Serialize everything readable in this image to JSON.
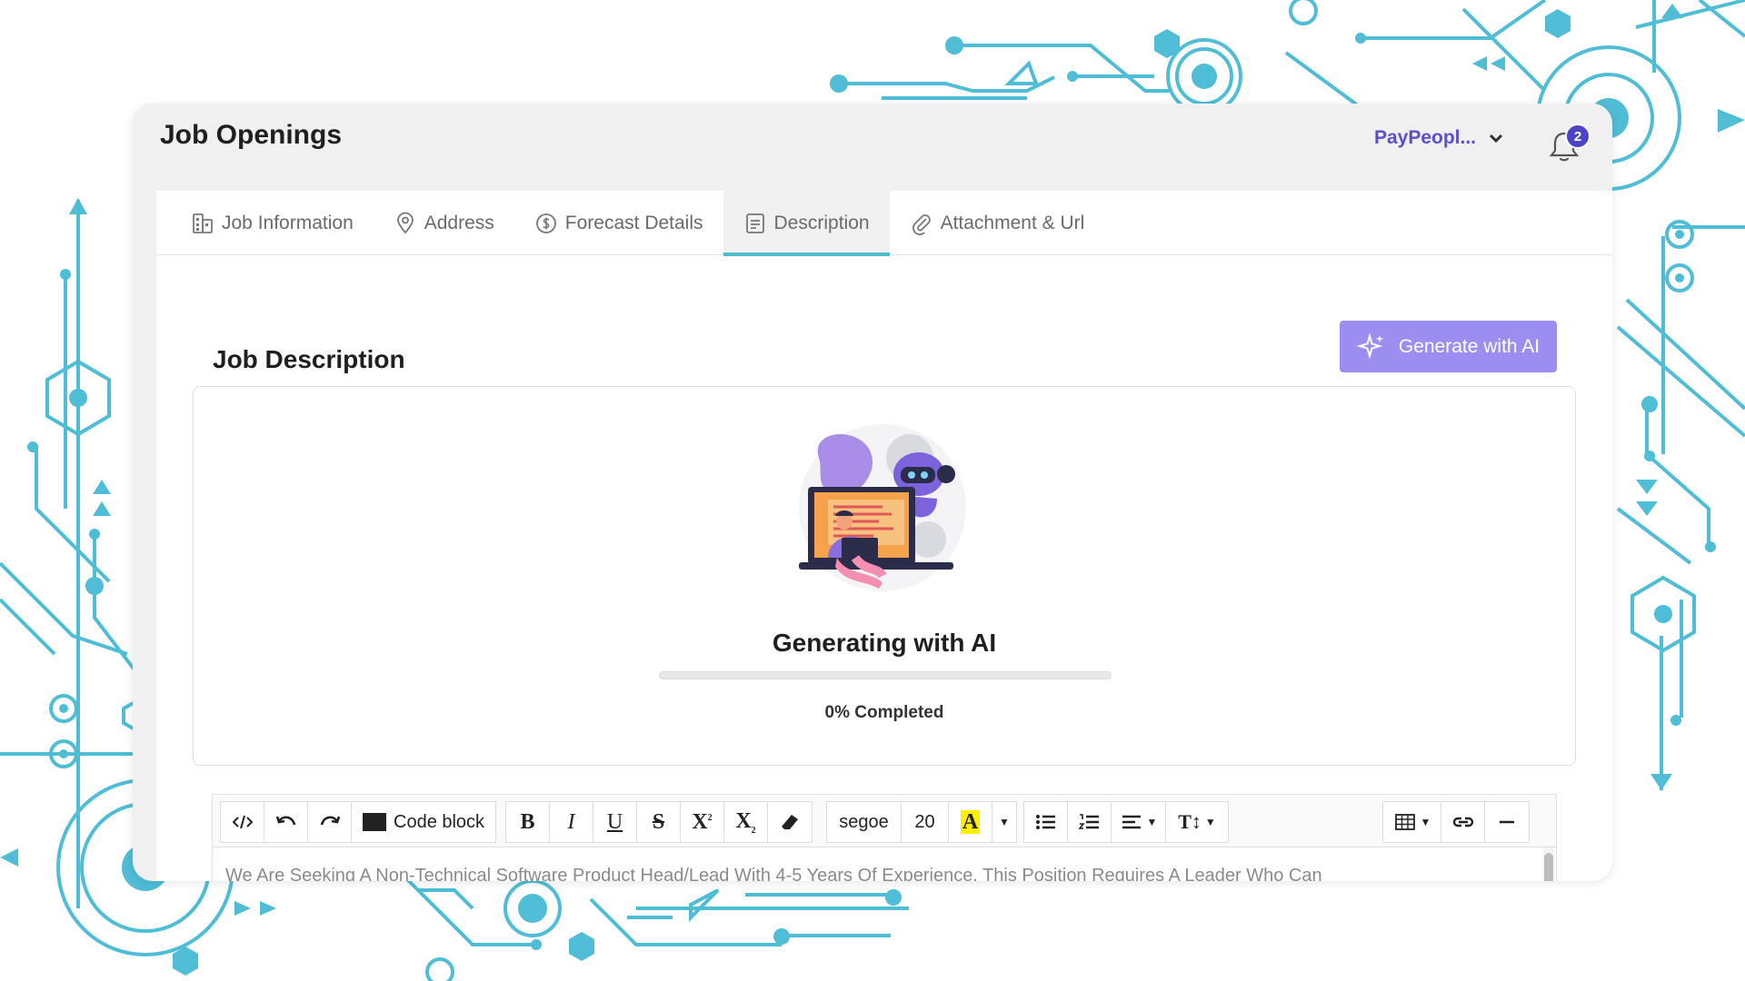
{
  "header": {
    "title": "Job Openings",
    "org_name": "PayPeopl...",
    "notification_count": "2"
  },
  "tabs": [
    {
      "label": "Job Information",
      "icon": "building-icon"
    },
    {
      "label": "Address",
      "icon": "location-pin-icon"
    },
    {
      "label": "Forecast Details",
      "icon": "dollar-coin-icon"
    },
    {
      "label": "Description",
      "icon": "document-icon",
      "active": true
    },
    {
      "label": "Attachment & Url",
      "icon": "paperclip-icon"
    }
  ],
  "description": {
    "section_title": "Job Description",
    "generate_button": "Generate with AI",
    "generating_title": "Generating with AI",
    "progress_percent": 0,
    "progress_text": "0% Completed"
  },
  "toolbar": {
    "code_block": "Code block",
    "font_name": "segoe",
    "font_size": "20"
  },
  "editor": {
    "content_preview": "We Are Seeking A Non-Technical Software Product Head/Lead With 4-5 Years Of Experience. This Position Requires A Leader Who Can"
  },
  "colors": {
    "accent_purple": "#9b8ef0",
    "brand_purple": "#5a4fcf",
    "tab_underline": "#4fbdc9",
    "circuit_cyan": "#4fbdd6"
  }
}
